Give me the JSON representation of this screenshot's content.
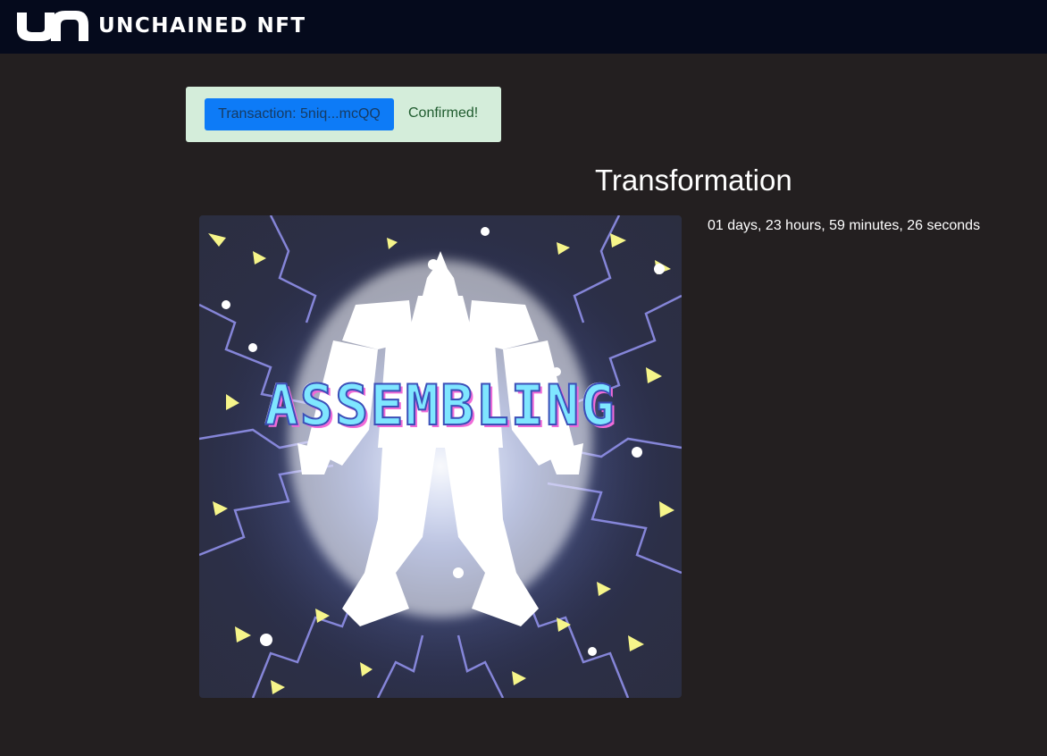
{
  "header": {
    "logo_icon": "unchained-logo-icon",
    "brand": "UNCHAINED NFT"
  },
  "alert": {
    "transaction_label": "Transaction: 5niq...mcQQ",
    "status_text": "Confirmed!",
    "colors": {
      "background": "#d4edda",
      "button": "#0d7bf7"
    }
  },
  "main": {
    "title": "Transformation",
    "countdown": "01 days, 23 hours, 59 minutes, 26 seconds",
    "nft_image": {
      "overlay_text": "ASSEMBLING"
    }
  },
  "theme": {
    "page_background": "#231f20",
    "topbar_background": "#050a1c"
  }
}
